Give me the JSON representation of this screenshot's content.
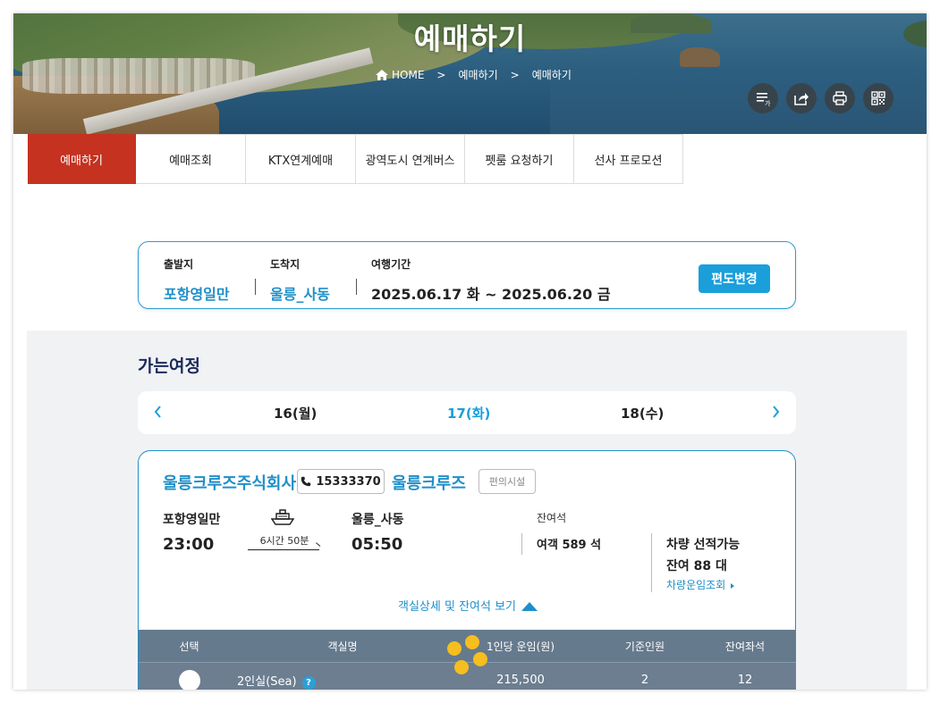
{
  "header": {
    "title": "예매하기",
    "breadcrumb": [
      "HOME",
      ">",
      "예매하기",
      ">",
      "예매하기"
    ],
    "tools": [
      "text-size-icon",
      "share-icon",
      "print-icon",
      "qr-code-icon"
    ]
  },
  "tabs": [
    "예매하기",
    "예매조회",
    "KTX연계예매",
    "광역도시 연계버스",
    "펫룸 요청하기",
    "선사 프로모션"
  ],
  "search": {
    "departure_label": "출발지",
    "departure": "포항영일만",
    "arrival_label": "도착지",
    "arrival": "울릉_사동",
    "period_label": "여행기간",
    "period": "2025.06.17 화 ~ 2025.06.20 금",
    "change_button": "편도변경"
  },
  "outbound": {
    "title": "가는여정",
    "dates": [
      "16(월)",
      "17(화)",
      "18(수)"
    ],
    "selected_date": "17(화)"
  },
  "ship": {
    "company": "울릉크루즈주식회사",
    "phone": "15333370",
    "name": "울릉크루즈",
    "facilities_button": "편의시설",
    "from_port": "포항영일만",
    "from_time": "23:00",
    "duration": "6시간 50분",
    "to_port": "울릉_사동",
    "to_time": "05:50",
    "remaining_label": "잔여석",
    "passenger_remaining": "여객 589 석",
    "vehicle_available": "차량 선적가능",
    "vehicle_remaining": "잔여 88 대",
    "vehicle_fare_link": "차량운임조회",
    "detail_toggle": "객실상세 및 잔여석 보기"
  },
  "room_table": {
    "headers": [
      "선택",
      "객실명",
      "1인당 운임(원)",
      "기준인원",
      "잔여좌석"
    ],
    "rows": [
      {
        "name": "2인실(Sea)",
        "help": "?",
        "fare": "215,500",
        "base": "2",
        "remaining": "12"
      }
    ]
  },
  "colors": {
    "active_tab": "#c53220",
    "accent_blue": "#1f8fc9",
    "button_blue": "#1a9fdb",
    "table_header": "#667a8d",
    "loading_dots": "#f6be1e"
  }
}
